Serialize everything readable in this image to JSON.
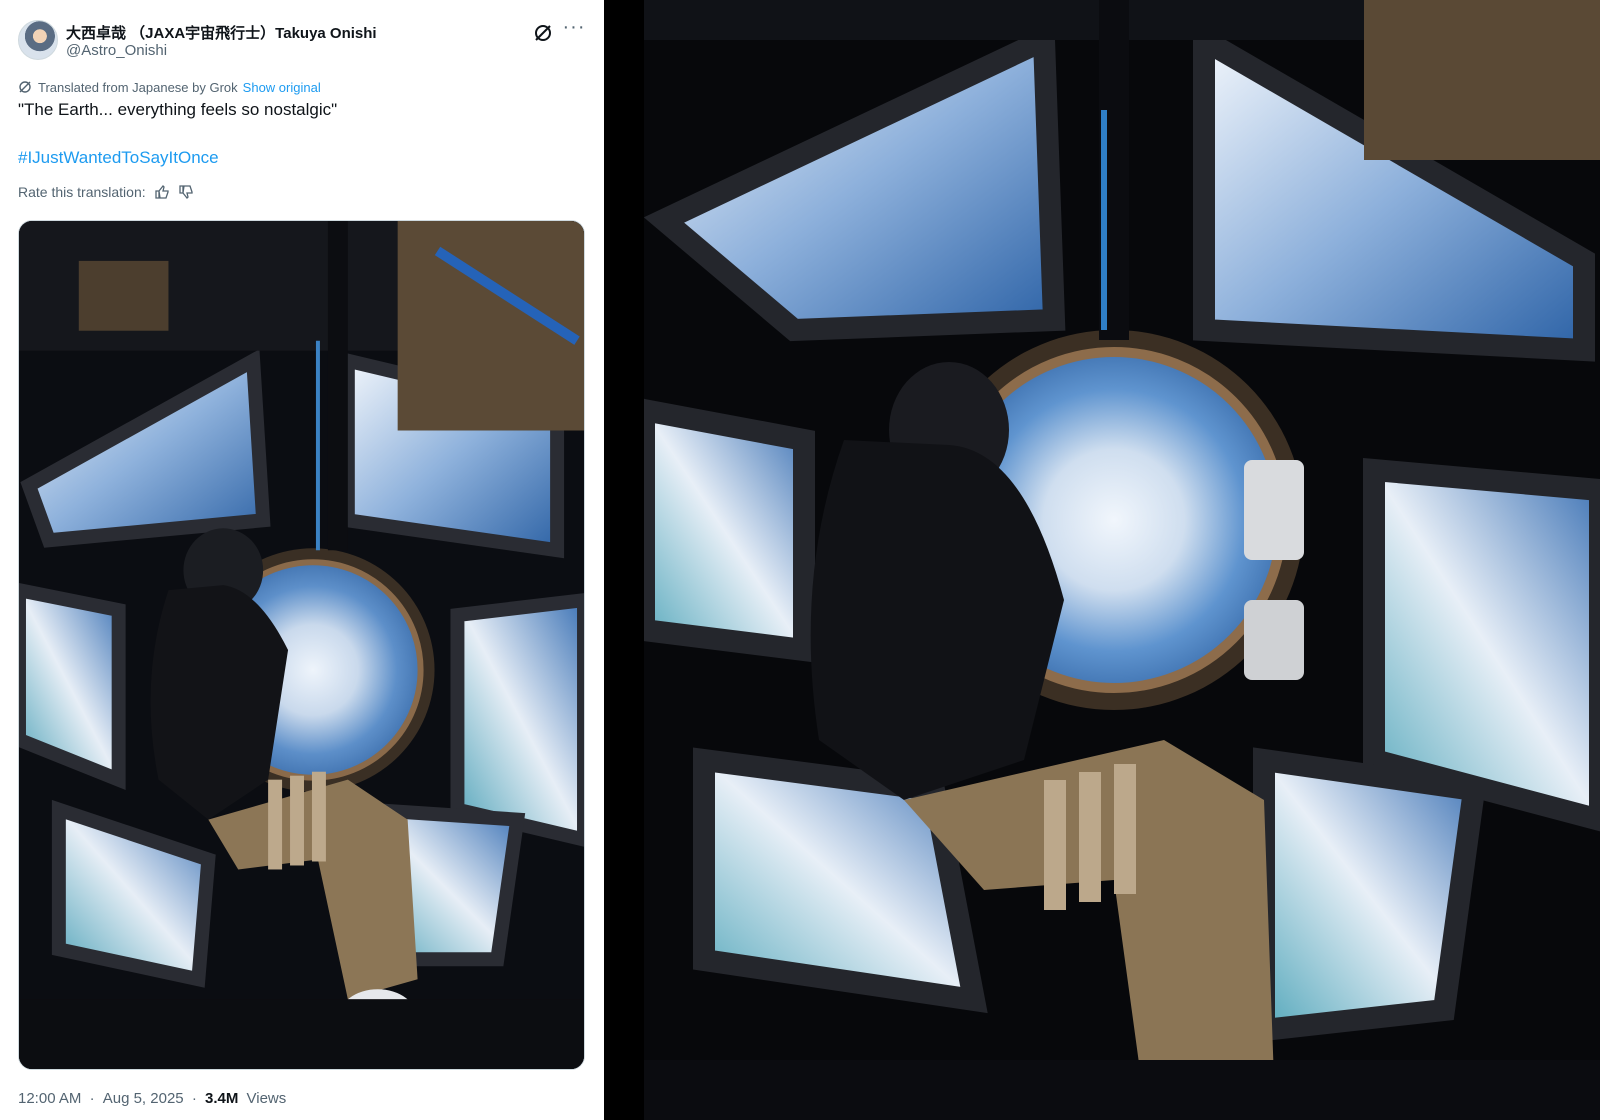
{
  "tweet": {
    "author": {
      "display_name": "大西卓哉 （JAXA宇宙飛行士）Takuya Onishi",
      "handle": "@Astro_Onishi"
    },
    "translation": {
      "label": "Translated from Japanese by Grok",
      "show_original": "Show original"
    },
    "text": "\"The Earth... everything feels so nostalgic\"",
    "hashtag": "#IJustWantedToSayItOnce",
    "rate_label": "Rate this translation:",
    "meta": {
      "time": "12:00 AM",
      "separator": "·",
      "date": "Aug 5, 2025",
      "views_count": "3.4M",
      "views_label": "Views"
    },
    "icons": {
      "grok": "grok-icon",
      "more": "more-icon",
      "thumbs_up": "thumbs-up-icon",
      "thumbs_down": "thumbs-down-icon"
    }
  },
  "colors": {
    "link": "#1d9bf0",
    "text_primary": "#0f1419",
    "text_secondary": "#536471",
    "backdrop": "#000000"
  }
}
